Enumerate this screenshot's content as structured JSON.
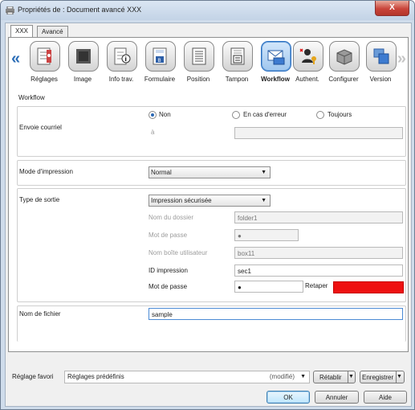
{
  "window": {
    "title": "Propriétés de : Document avancé XXX",
    "close_label": "X"
  },
  "tabs": [
    "XXX",
    "Avancé"
  ],
  "toolbar": {
    "items": [
      {
        "label": "Réglages",
        "icon": "settings-icon"
      },
      {
        "label": "Image",
        "icon": "image-icon"
      },
      {
        "label": "Info trav.",
        "icon": "job-info-icon"
      },
      {
        "label": "Formulaire",
        "icon": "form-icon"
      },
      {
        "label": "Position",
        "icon": "position-icon"
      },
      {
        "label": "Tampon",
        "icon": "stamp-icon"
      },
      {
        "label": "Workflow",
        "icon": "workflow-icon"
      },
      {
        "label": "Authent.",
        "icon": "authentication-icon"
      },
      {
        "label": "Configurer",
        "icon": "configure-icon"
      },
      {
        "label": "Version",
        "icon": "version-icon"
      }
    ],
    "selected": "Workflow"
  },
  "section_title": "Workflow",
  "email": {
    "label": "Envoie courriel",
    "options": [
      "Non",
      "En cas d'erreur",
      "Toujours"
    ],
    "selected": "Non",
    "to_label": "à",
    "to_value": ""
  },
  "print_mode": {
    "label": "Mode d'impression",
    "value": "Normal"
  },
  "output": {
    "label": "Type de sortie",
    "value": "Impression sécurisée",
    "folder_label": "Nom du dossier",
    "folder_value": "folder1",
    "password_label": "Mot de passe",
    "password_value": "●",
    "user_box_label": "Nom boîte utilisateur",
    "user_box_value": "box11",
    "print_id_label": "ID impression",
    "print_id_value": "sec1",
    "secure_password_label": "Mot de passe",
    "secure_password_value": "●",
    "retype_label": "Retaper"
  },
  "file_name": {
    "label": "Nom de fichier",
    "value": "sample"
  },
  "favorite": {
    "label": "Réglage favori",
    "value": "Réglages prédéfinis",
    "modified": "(modifié)",
    "restore": "Rétablir",
    "save": "Enregistrer"
  },
  "buttons": {
    "ok": "OK",
    "cancel": "Annuler",
    "help": "Aide"
  },
  "colors": {
    "accent": "#2b68b4",
    "retype_error": "#ee1111"
  }
}
